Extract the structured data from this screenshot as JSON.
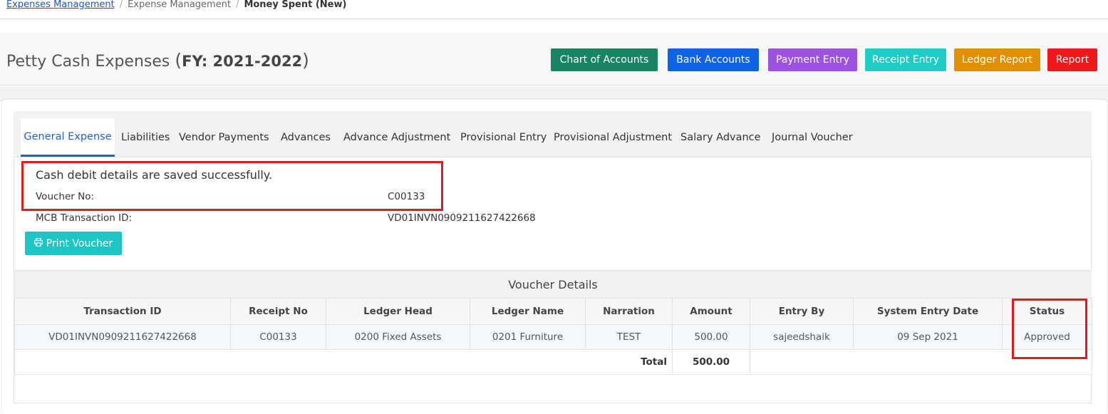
{
  "breadcrumb": {
    "link": "Expenses Management",
    "middle": "Expense Management",
    "current": "Money Spent (New)"
  },
  "header": {
    "title": "Petty Cash Expenses",
    "fy_label": "FY: 2021-2022",
    "buttons": {
      "chart_of_accounts": "Chart of Accounts",
      "bank_accounts": "Bank Accounts",
      "payment_entry": "Payment Entry",
      "receipt_entry": "Receipt Entry",
      "ledger_report": "Ledger Report",
      "report": "Report"
    },
    "button_colors": {
      "chart_of_accounts": "#178563",
      "bank_accounts": "#0d63e6",
      "payment_entry": "#9b52e0",
      "receipt_entry": "#1dcdc5",
      "ledger_report": "#e39000",
      "report": "#f01818"
    }
  },
  "tabs": [
    {
      "label": "General Expense",
      "active": true
    },
    {
      "label": "Liabilities",
      "active": false
    },
    {
      "label": "Vendor Payments",
      "active": false
    },
    {
      "label": "Advances",
      "active": false
    },
    {
      "label": "Advance Adjustment",
      "active": false
    },
    {
      "label": "Provisional Entry",
      "active": false
    },
    {
      "label": "Provisional Adjustment",
      "active": false
    },
    {
      "label": "Salary Advance",
      "active": false
    },
    {
      "label": "Journal Voucher",
      "active": false
    }
  ],
  "result": {
    "message": "Cash debit details are saved successfully.",
    "voucher_no_label": "Voucher No:",
    "voucher_no": "C00133",
    "mcb_label": "MCB Transaction ID:",
    "mcb_id": "VD01INVN0909211627422668",
    "print_button": "Print Voucher",
    "print_icon": "print-icon"
  },
  "voucher_details": {
    "title": "Voucher Details",
    "columns": [
      "Transaction ID",
      "Receipt No",
      "Ledger Head",
      "Ledger Name",
      "Narration",
      "Amount",
      "Entry By",
      "System Entry Date",
      "Status"
    ],
    "rows": [
      [
        "VD01INVN0909211627422668",
        "C00133",
        "0200 Fixed Assets",
        "0201 Furniture",
        "TEST",
        "500.00",
        "sajeedshaik",
        "09 Sep 2021",
        "Approved"
      ]
    ],
    "total_label": "Total",
    "total_amount": "500.00"
  },
  "highlight_color": "#e01b1b"
}
